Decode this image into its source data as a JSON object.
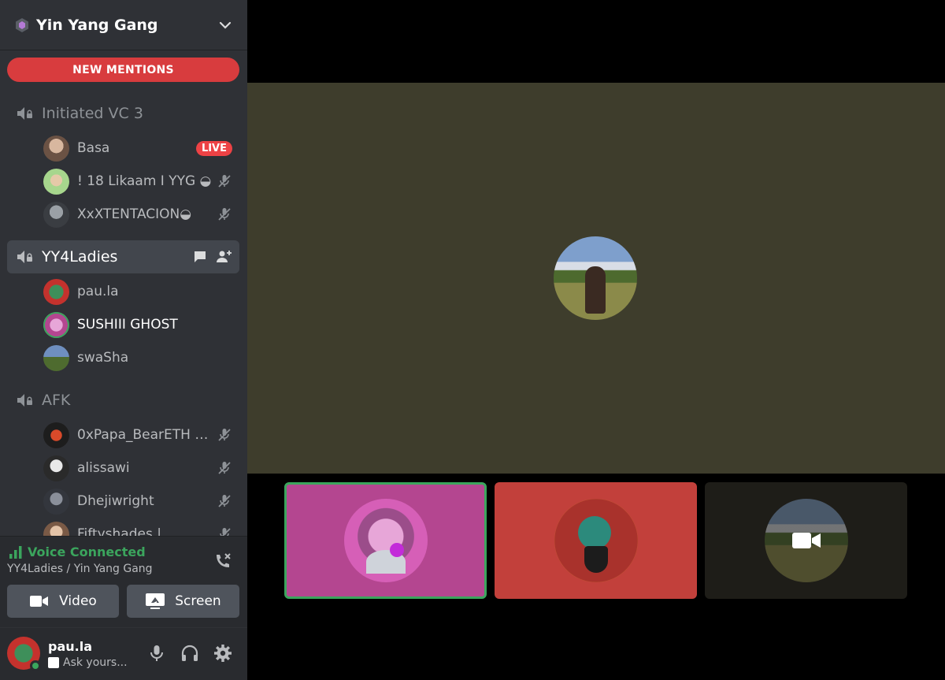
{
  "server": {
    "name": "Yin Yang Gang"
  },
  "banner": {
    "new_mentions": "NEW MENTIONS"
  },
  "channels": [
    {
      "name": "Initiated VC 3",
      "active": false,
      "users": [
        {
          "name": "Basa",
          "badge": "LIVE",
          "muted": false
        },
        {
          "name": "! 18 Likaam I YYG ◒",
          "muted": true
        },
        {
          "name": "XxXTENTACION◒",
          "muted": true
        }
      ]
    },
    {
      "name": "YY4Ladies",
      "active": true,
      "users": [
        {
          "name": "pau.la",
          "muted": false
        },
        {
          "name": "SUSHIII GHOST",
          "muted": false
        },
        {
          "name": "swaSha",
          "muted": false
        }
      ]
    },
    {
      "name": "AFK",
      "active": false,
      "users": [
        {
          "name": "0xPapa_BearETH ◒...",
          "muted": true
        },
        {
          "name": "alissawi",
          "muted": true
        },
        {
          "name": "Dhejiwright",
          "muted": true
        },
        {
          "name": "Fiftyshades |",
          "muted": true
        }
      ]
    }
  ],
  "voice": {
    "status": "Voice Connected",
    "location": "YY4Ladies / Yin Yang Gang",
    "video_label": "Video",
    "screen_label": "Screen"
  },
  "self": {
    "name": "pau.la",
    "status_text": "Ask yours..."
  },
  "colors": {
    "sidebar": "#2f3136",
    "panel": "#292b2f",
    "accent_green": "#3ba55d",
    "danger_red": "#ed4245",
    "stage_bg": "#3e3d2c",
    "tile_pink": "#b44690",
    "tile_red": "#c2403b",
    "tile_dark": "#1e1d18"
  }
}
